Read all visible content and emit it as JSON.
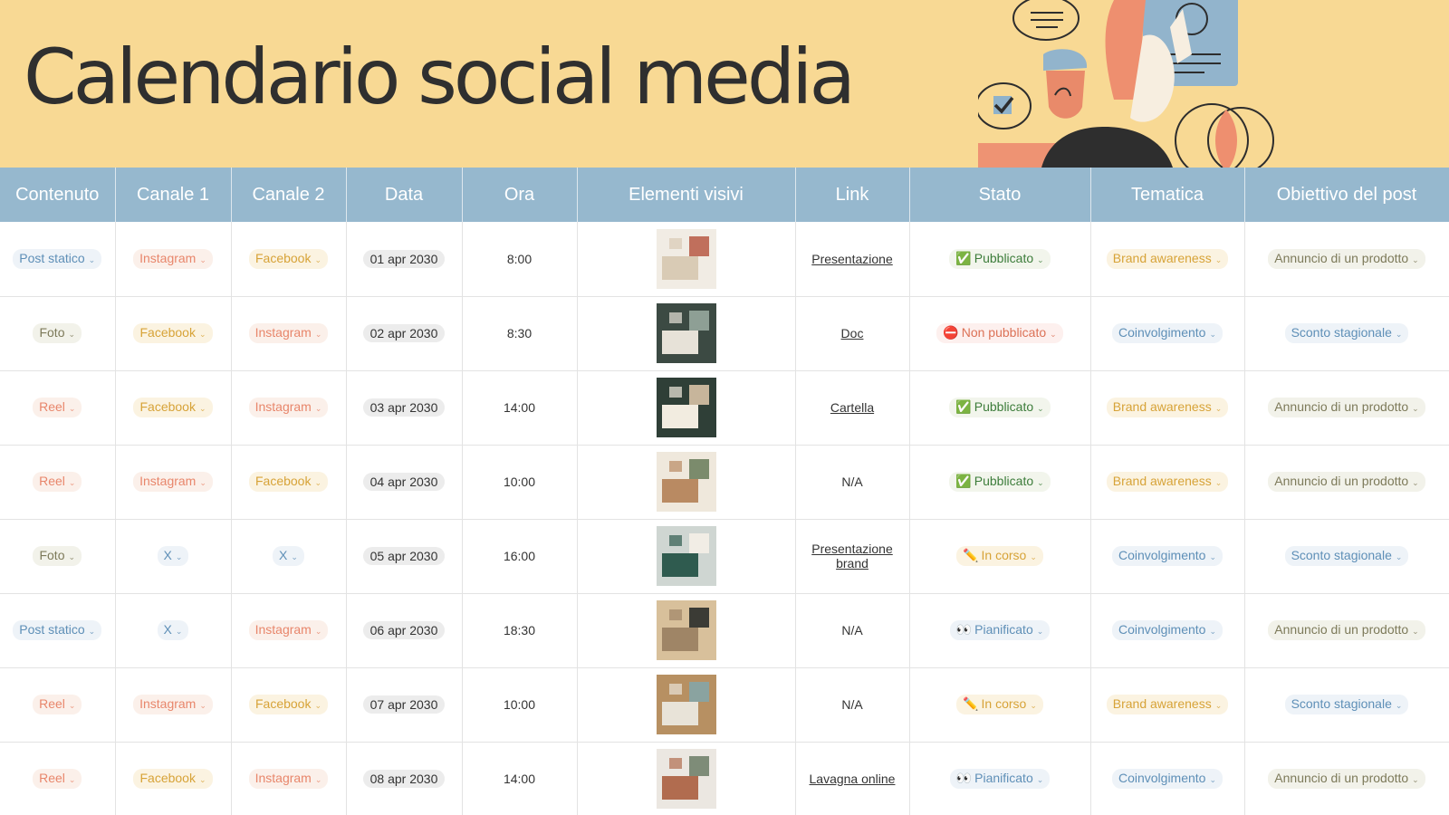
{
  "title": "Calendario social media",
  "colors": {
    "header_bg": "#f8d994",
    "table_header_bg": "#96b8ce",
    "blue": "#5e8fb7",
    "orange": "#e8866b",
    "gold": "#d7a338",
    "olive": "#7d7a5a"
  },
  "columns": [
    "Contenuto",
    "Canale 1",
    "Canale 2",
    "Data",
    "Ora",
    "Elementi visivi",
    "Link",
    "Stato",
    "Tematica",
    "Obiettivo del post"
  ],
  "rows": [
    {
      "contenuto": "Post statico",
      "canale1": "Instagram",
      "canale2": "Facebook",
      "data": "01 apr 2030",
      "ora": "8:00",
      "link": "Presentazione",
      "stato": "Pubblicato",
      "stato_icon": "check-icon",
      "tematica": "Brand awareness",
      "obiettivo": "Annuncio di un prodotto"
    },
    {
      "contenuto": "Foto",
      "canale1": "Facebook",
      "canale2": "Instagram",
      "data": "02 apr 2030",
      "ora": "8:30",
      "link": "Doc",
      "stato": "Non pubblicato",
      "stato_icon": "no-entry-icon",
      "tematica": "Coinvolgimento",
      "obiettivo": "Sconto stagionale"
    },
    {
      "contenuto": "Reel",
      "canale1": "Facebook",
      "canale2": "Instagram",
      "data": "03 apr 2030",
      "ora": "14:00",
      "link": "Cartella",
      "stato": "Pubblicato",
      "stato_icon": "check-icon",
      "tematica": "Brand awareness",
      "obiettivo": "Annuncio di un prodotto"
    },
    {
      "contenuto": "Reel",
      "canale1": "Instagram",
      "canale2": "Facebook",
      "data": "04 apr 2030",
      "ora": "10:00",
      "link": "N/A",
      "stato": "Pubblicato",
      "stato_icon": "check-icon",
      "tematica": "Brand awareness",
      "obiettivo": "Annuncio di un prodotto"
    },
    {
      "contenuto": "Foto",
      "canale1": "X",
      "canale2": "X",
      "data": "05 apr 2030",
      "ora": "16:00",
      "link": "Presentazione brand",
      "stato": "In corso",
      "stato_icon": "pencil-icon",
      "tematica": "Coinvolgimento",
      "obiettivo": "Sconto stagionale"
    },
    {
      "contenuto": "Post statico",
      "canale1": "X",
      "canale2": "Instagram",
      "data": "06 apr 2030",
      "ora": "18:30",
      "link": "N/A",
      "stato": "Pianificato",
      "stato_icon": "eyes-icon",
      "tematica": "Coinvolgimento",
      "obiettivo": "Annuncio di un prodotto"
    },
    {
      "contenuto": "Reel",
      "canale1": "Instagram",
      "canale2": "Facebook",
      "data": "07 apr 2030",
      "ora": "10:00",
      "link": "N/A",
      "stato": "In corso",
      "stato_icon": "pencil-icon",
      "tematica": "Brand awareness",
      "obiettivo": "Sconto stagionale"
    },
    {
      "contenuto": "Reel",
      "canale1": "Facebook",
      "canale2": "Instagram",
      "data": "08 apr 2030",
      "ora": "14:00",
      "link": "Lavagna online",
      "stato": "Pianificato",
      "stato_icon": "eyes-icon",
      "tematica": "Coinvolgimento",
      "obiettivo": "Annuncio di un prodotto"
    }
  ]
}
